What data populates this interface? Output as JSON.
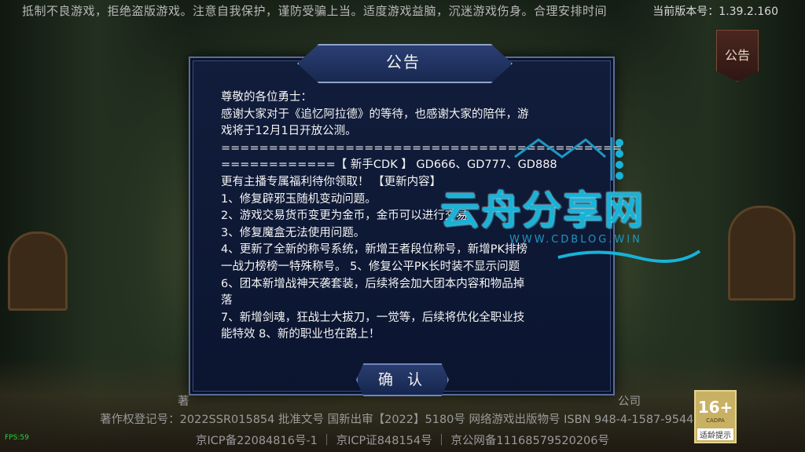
{
  "header": {
    "marquee": "抵制不良游戏，拒绝盗版游戏。注意自我保护，谨防受骗上当。适度游戏益脑，沉迷游戏伤身。合理安排时间",
    "version": "当前版本号：1.39.2.160",
    "notice_tab": "公告"
  },
  "dialog": {
    "title": "公告",
    "lines": [
      "尊敬的各位勇士：",
      "感谢大家对于《追忆阿拉德》的等待，也感谢大家的陪伴，游",
      "戏将于12月1日开放公测。",
      "==========================================",
      "============【 新手CDK 】 GD666、GD777、GD888",
      "更有主播专属福利待你领取！ 【更新内容】",
      "1、修复辟邪玉随机变动问题。",
      "2、游戏交易货币变更为金币，金币可以进行交易。",
      "3、修复魔盒无法使用问题。",
      "4、更新了全新的称号系统，新增王者段位称号，新增PK排榜",
      "一战力榜榜一特殊称号。 5、修复公平PK长时装不显示问题",
      "6、团本新增战神天袭套装，后续将会加大团本内容和物品掉",
      "落",
      "7、新增剑魂，狂战士大拔刀，一觉等，后续将优化全职业技",
      "能特效 8、新的职业也在路上！"
    ],
    "confirm_label": "确 认"
  },
  "footer": {
    "line1_left": "著",
    "line1_right": "公司",
    "line2": "著作权登记号：2022SSR015854 批准文号 国新出审【2022】5180号 网络游戏出版物号 ISBN 948-4-1587-9544-2",
    "line3": "京ICP备22084816号-1 ｜ 京ICP证848154号 ｜ 京公网备11168579520206号"
  },
  "age_badge": {
    "rating": "16+",
    "sub": "CADPA",
    "tip": "适龄提示"
  },
  "fps": "FPS:59",
  "watermark": {
    "text": "云舟分享网",
    "url": "WWW.CDBLOG.WIN"
  },
  "colors": {
    "dialog_bg": "#0d1833",
    "dialog_border": "#5a6d99",
    "watermark": "#17b3d8",
    "fps": "#28d43a"
  }
}
